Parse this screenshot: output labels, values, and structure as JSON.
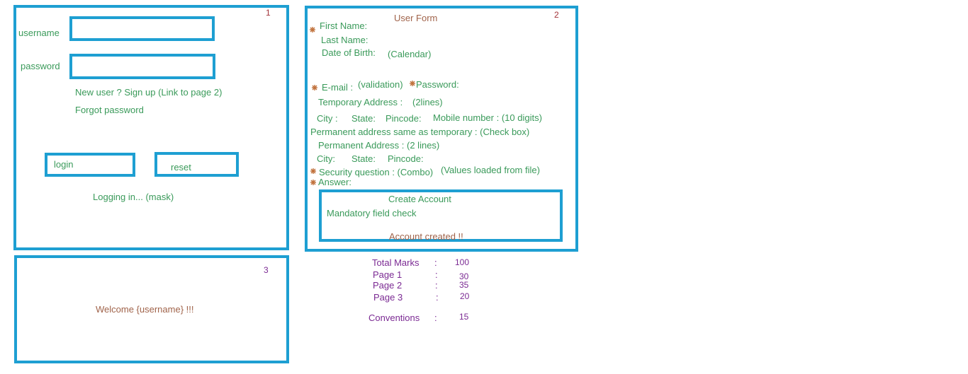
{
  "page1": {
    "number": "1",
    "username_label": "username",
    "password_label": "password",
    "new_user_text": "New user ?  Sign up (Link to page 2)",
    "forgot_password": "Forgot password",
    "login_button": "login",
    "reset_button": "reset",
    "logging_in": "Logging in... (mask)"
  },
  "page2": {
    "number": "2",
    "title": "User Form",
    "first_name": "First Name:",
    "last_name": "Last Name:",
    "dob": "Date of Birth:",
    "calendar": "(Calendar)",
    "email": "E-mail :",
    "validation": "(validation)",
    "password": "Password:",
    "temp_address": "Temporary Address :",
    "two_lines_a": "(2lines)",
    "city": "City :",
    "state": "State:",
    "pincode": "Pincode:",
    "mobile": "Mobile number : (10 digits)",
    "perm_same": "Permanent address same as temporary : (Check box)",
    "perm_address": "Permanent Address : (2 lines)",
    "city2": "City:",
    "state2": "State:",
    "pincode2": "Pincode:",
    "security_q": "Security question : (Combo)",
    "values_loaded": "(Values loaded from file)",
    "answer": "Answer:",
    "create_account": "Create Account",
    "mandatory_check": "Mandatory field check",
    "account_created": "Account created !!"
  },
  "page3": {
    "number": "3",
    "welcome": "Welcome {username} !!!"
  },
  "marks": {
    "total_label": "Total Marks",
    "total_value": "100",
    "page1_label": "Page  1",
    "page1_value": "30",
    "page2_label": "Page  2",
    "page2_value": "35",
    "page3_label": "Page  3",
    "page3_value": "20",
    "conventions_label": "Conventions",
    "conventions_value": "15",
    "colon": ":"
  },
  "colors": {
    "box_border": "#1e9fd2",
    "text_green": "#3a9a5a",
    "text_brown": "#a0634a",
    "text_purple": "#7b2a93",
    "mandatory_star": "#c0703a"
  },
  "icons": {
    "mandatory": "asterisk-icon"
  }
}
